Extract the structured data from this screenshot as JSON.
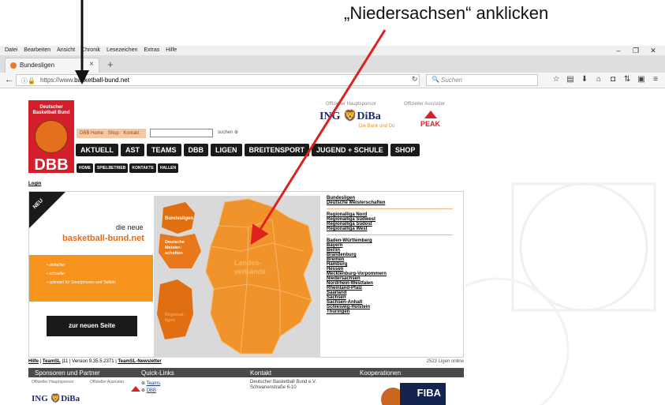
{
  "annotation": {
    "instruction": "„Niedersachsen“ anklicken"
  },
  "browser": {
    "menu": [
      "Datei",
      "Bearbeiten",
      "Ansicht",
      "Chronik",
      "Lesezeichen",
      "Extras",
      "Hilfe"
    ],
    "tab_title": "Bundesligen",
    "url_prefix": "https://www.",
    "url_domain": "basketball-bund.net",
    "search_placeholder": "Suchen"
  },
  "header": {
    "logo_lines": [
      "Deutscher",
      "Basketball Bund"
    ],
    "logo_abbr": "DBB",
    "toplinks": [
      "DBB Home",
      "Shop",
      "Kontakt"
    ],
    "search_button": "suchen",
    "main_nav": [
      "AKTUELL",
      "AST",
      "TEAMS",
      "DBB",
      "LIGEN",
      "BREITENSPORT",
      "JUGEND + SCHULE",
      "SHOP"
    ],
    "sub_nav": [
      "HOME",
      "SPIELBETRIEB",
      "KONTAKTE",
      "HALLEN"
    ],
    "sponsor_label": "Offizieller Hauptsponsor",
    "outfitter_label": "Offizieller Ausrüster",
    "sponsor_name_a": "ING",
    "sponsor_name_b": "DiBa",
    "sponsor_tagline": "Die Bank und Du",
    "outfitter_name": "PEAK"
  },
  "login": "Login",
  "promo": {
    "badge": "NEU",
    "die_neue": "die neue",
    "site": "basketball-bund.net",
    "bullets": [
      "einfacher",
      "schneller",
      "optimiert für Smartphones und Tablets"
    ],
    "button": "zur neuen Seite"
  },
  "map": {
    "bundesligen": "Bundesligen",
    "meister": [
      "Deutsche",
      "Meister-",
      "schaften"
    ],
    "landes": [
      "Landes-",
      "verbände"
    ],
    "regional": [
      "Regional-",
      "ligen"
    ]
  },
  "links": {
    "group1": [
      "Bundesligen",
      "Deutsche Meisterschaften"
    ],
    "group2": [
      "Regionalliga Nord",
      "Regionalliga Südwest",
      "Regionalliga Südost",
      "Regionalliga West"
    ],
    "group3": [
      "Baden-Württemberg",
      "Bayern",
      "Berlin",
      "Brandenburg",
      "Bremen",
      "Hamburg",
      "Hessen",
      "Mecklenburg-Vorpommern",
      "Niedersachsen",
      "Nordrhein-Westfalen",
      "Rheinland-Pfalz",
      "Saarland",
      "Sachsen",
      "Sachsen-Anhalt",
      "Schleswig-Holstein",
      "Thüringen"
    ]
  },
  "footer": {
    "hilfe": "Hilfe",
    "teamsl": "TeamSL",
    "version": "|11 | Version 9.35.5.2371 |",
    "newsletter": "TeamSL-Newsletter",
    "online": "2523 Ligen online"
  },
  "bottom": {
    "heads": [
      "Sponsoren und Partner",
      "Quick-Links",
      "Kontakt",
      "Kooperationen"
    ],
    "sponsor_small": "Offizieller Hauptsponsor",
    "outfitter_small": "Offizieller Ausrüster",
    "quick_links": [
      "Teams",
      "DBB"
    ],
    "kontakt": [
      "Deutscher Basketball Bund e.V.",
      "Schwanenstraße 6-10"
    ],
    "koop": "FIBA"
  }
}
